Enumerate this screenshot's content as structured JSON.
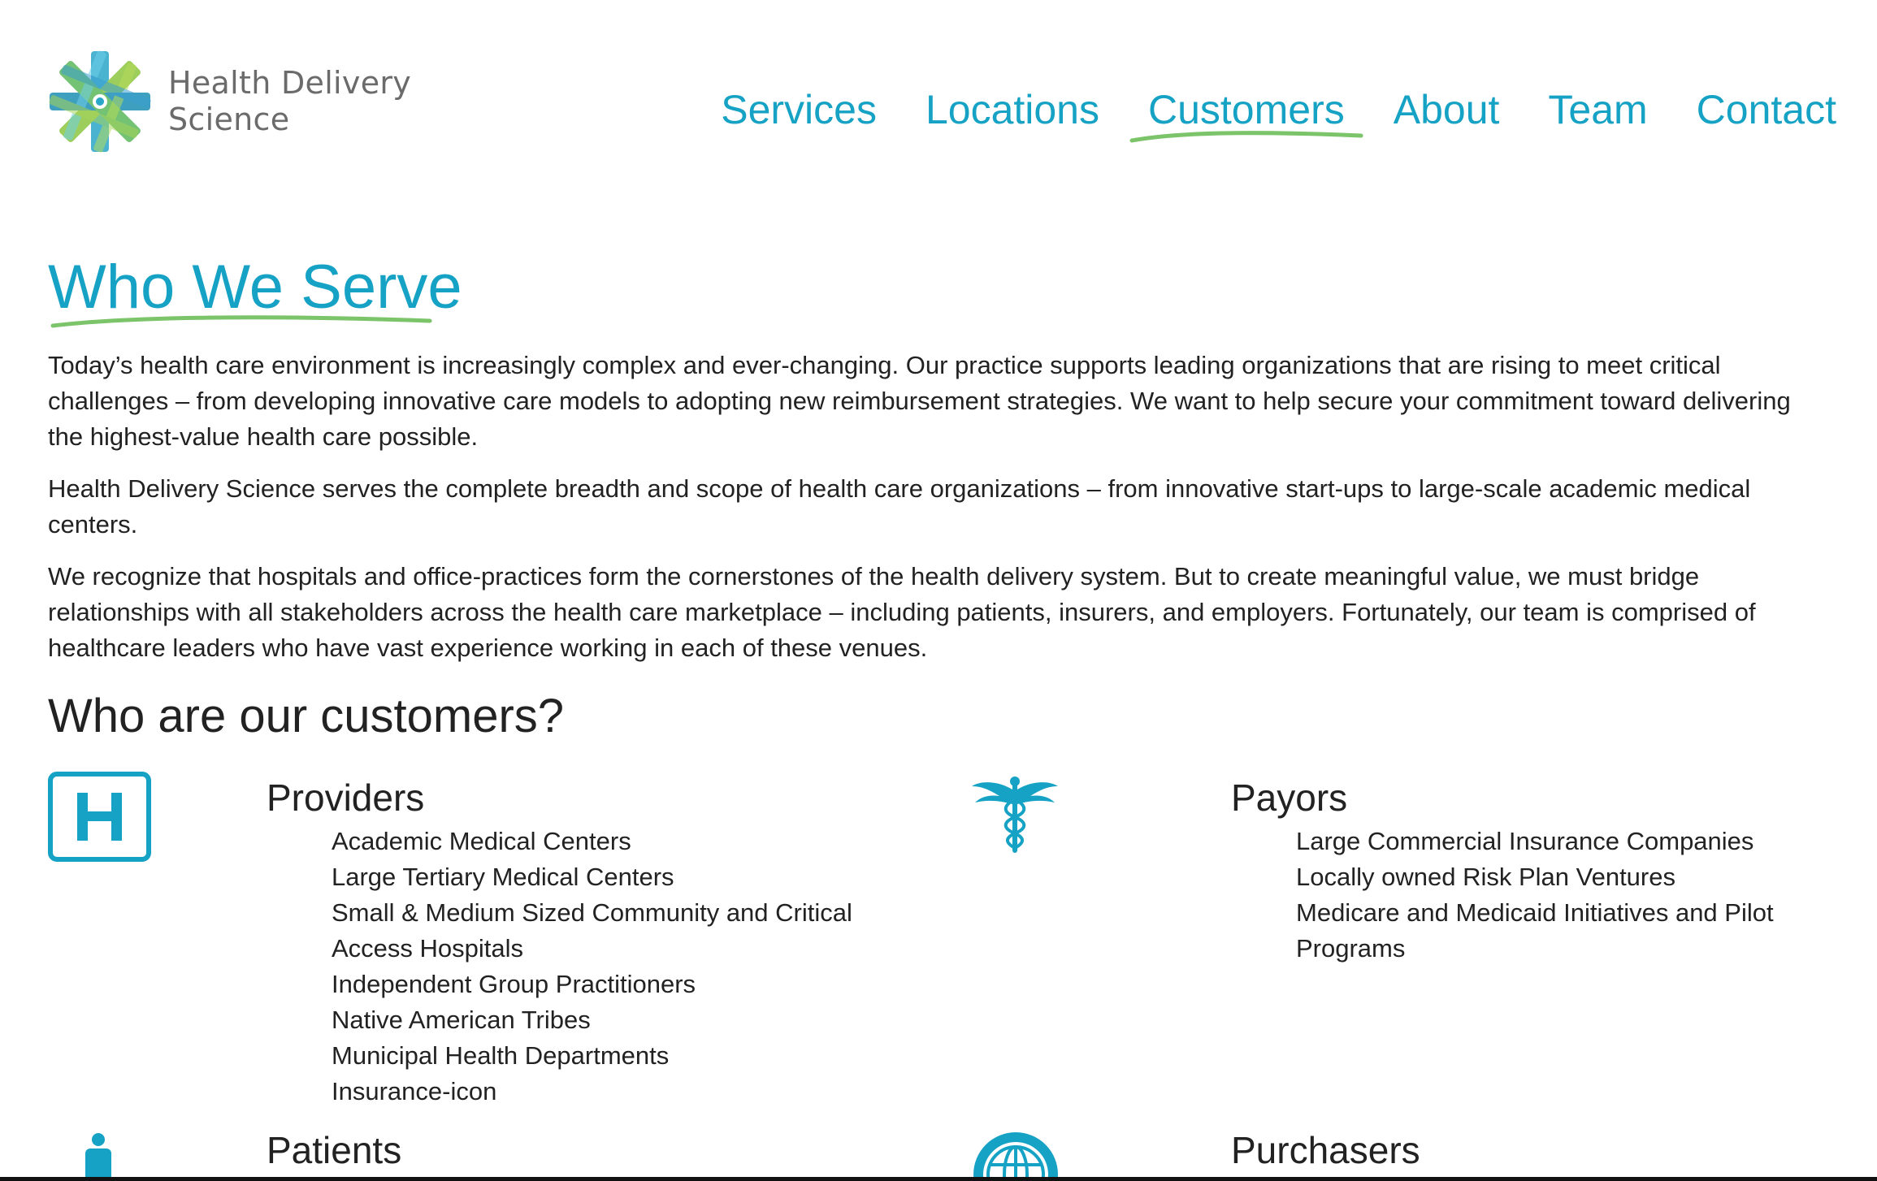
{
  "brand": {
    "name_line1": "Health Delivery",
    "name_line2": "Science",
    "accent_color": "#16a2c4",
    "underline_color": "#7cc46a"
  },
  "nav": {
    "items": [
      {
        "label": "Services"
      },
      {
        "label": "Locations"
      },
      {
        "label": "Customers",
        "active": true
      },
      {
        "label": "About"
      },
      {
        "label": "Team"
      },
      {
        "label": "Contact"
      }
    ]
  },
  "page": {
    "title": "Who We Serve",
    "paragraphs": [
      "Today’s health care environment is increasingly complex and ever-changing. Our practice supports leading organizations that are rising to meet critical challenges – from developing innovative care models to adopting new reimbursement strategies. We want to help secure your commitment toward delivering the highest-value health care possible.",
      "Health Delivery Science serves the complete breadth and scope of health care organizations – from innovative start-ups to large-scale academic medical centers.",
      "We recognize that hospitals and office-practices form the cornerstones of the health delivery system. But to create meaningful value, we must bridge relationships with all stakeholders across the health care marketplace – including patients, insurers, and employers. Fortunately, our team is comprised of healthcare leaders who have vast experience working in each of these venues."
    ],
    "section_heading": "Who are our customers?"
  },
  "customers": {
    "providers": {
      "title": "Providers",
      "icon": "hospital-h-icon",
      "items": [
        "Academic Medical Centers",
        "Large Tertiary Medical Centers",
        "Small & Medium Sized Community and Critical Access Hospitals",
        "Independent Group Practitioners",
        "Native American Tribes",
        "Municipal Health Departments",
        "Insurance-icon"
      ]
    },
    "payors": {
      "title": "Payors",
      "icon": "caduceus-icon",
      "items": [
        "Large Commercial Insurance Companies",
        "Locally owned Risk Plan Ventures",
        "Medicare and Medicaid Initiatives and Pilot Programs"
      ]
    },
    "patients": {
      "title": "Patients",
      "icon": "person-icon"
    },
    "purchasers": {
      "title": "Purchasers",
      "icon": "globe-icon"
    }
  }
}
